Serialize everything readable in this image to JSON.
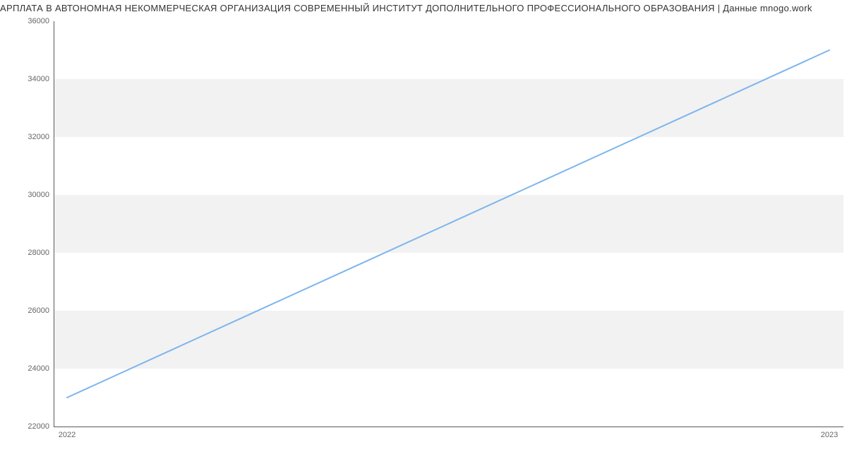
{
  "chart_data": {
    "type": "line",
    "title": "АРПЛАТА В АВТОНОМНАЯ НЕКОММЕРЧЕСКАЯ ОРГАНИЗАЦИЯ СОВРЕМЕННЫЙ ИНСТИТУТ ДОПОЛНИТЕЛЬНОГО ПРОФЕССИОНАЛЬНОГО ОБРАЗОВАНИЯ | Данные mnogo.work",
    "x": [
      "2022",
      "2023"
    ],
    "values": [
      23000,
      35000
    ],
    "xlabel": "",
    "ylabel": "",
    "ylim": [
      22000,
      36000
    ],
    "y_ticks": [
      22000,
      24000,
      26000,
      28000,
      30000,
      32000,
      34000,
      36000
    ],
    "x_ticks": [
      "2022",
      "2023"
    ],
    "line_color": "#7cb5ec"
  }
}
